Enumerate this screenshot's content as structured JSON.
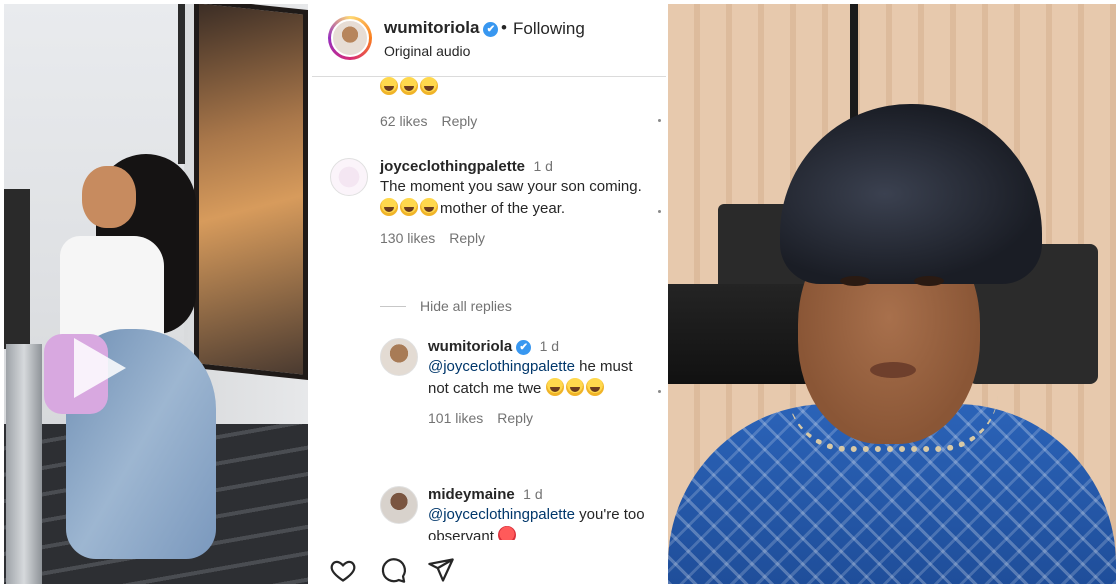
{
  "post_header": {
    "username": "wumitoriola",
    "verified_mark": "✔",
    "separator": "•",
    "follow_status": "Following",
    "audio": "Original audio"
  },
  "comments": [
    {
      "emojis": 3,
      "likes": "62 likes",
      "reply": "Reply"
    },
    {
      "username": "joyceclothingpalette",
      "time": "1 d",
      "text_before": "The moment you saw your son coming.",
      "text_after": "mother of the year.",
      "likes": "130 likes",
      "reply": "Reply",
      "replies_toggle": "Hide all replies"
    }
  ],
  "replies": [
    {
      "username": "wumitoriola",
      "verified_mark": "✔",
      "time": "1 d",
      "mention": "@joyceclothingpalette",
      "text": " he must not catch me twe",
      "likes": "101 likes",
      "reply": "Reply"
    },
    {
      "username": "mideymaine",
      "time": "1 d",
      "mention": "@joyceclothingpalette",
      "text": " you're too observant"
    }
  ],
  "actions": {
    "like_icon": "heart-icon",
    "comment_icon": "comment-icon",
    "share_icon": "send-icon"
  },
  "colors": {
    "verified": "#3897f0",
    "mention": "#00376b",
    "meta": "#737373"
  }
}
